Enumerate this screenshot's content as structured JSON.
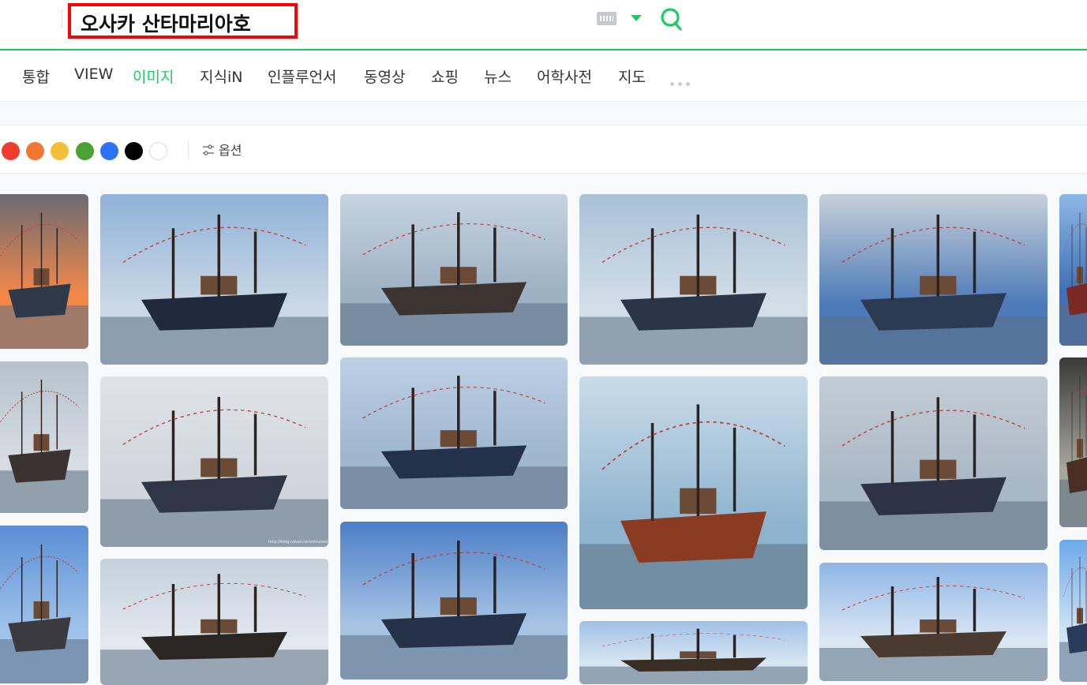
{
  "search": {
    "query": "오사카 산타마리아호"
  },
  "tabs": [
    {
      "label": "통합"
    },
    {
      "label": "VIEW"
    },
    {
      "label": "이미지",
      "active": true
    },
    {
      "label": "지식iN"
    },
    {
      "label": "인플루언서"
    },
    {
      "label": "동영상"
    },
    {
      "label": "쇼핑"
    },
    {
      "label": "뉴스"
    },
    {
      "label": "어학사전"
    },
    {
      "label": "지도"
    }
  ],
  "filters": {
    "colors": [
      "#ee3d2f",
      "#f07830",
      "#f6bd38",
      "#49a231",
      "#2d73f5",
      "#000000",
      "#ffffff"
    ],
    "options_label": "옵션"
  },
  "colors": {
    "accent": "#19ce60",
    "highlight_box": "#ff0000"
  },
  "images": [
    {
      "subject": "ship-sunset"
    },
    {
      "subject": "ship-blue-sky-pier"
    },
    {
      "subject": "ship-distance-pier"
    },
    {
      "subject": "ship-closeup-pier"
    },
    {
      "subject": "ship-cloudy-sky"
    },
    {
      "subject": "ship-partial"
    },
    {
      "subject": "ship-crowd"
    },
    {
      "subject": "ship-side-calm-water"
    },
    {
      "subject": "ship-with-boat"
    },
    {
      "subject": "ship-through-fence-cross-sail"
    },
    {
      "subject": "ship-overcast-harbor"
    },
    {
      "subject": "ship-dark-partial"
    },
    {
      "subject": "ship-close-mast"
    },
    {
      "subject": "ship-silhouette"
    },
    {
      "subject": "ship-blue-sky-boat"
    },
    {
      "subject": "ship-flags"
    },
    {
      "subject": "ship-mast-flags"
    },
    {
      "subject": "ship-partial-right"
    }
  ],
  "watermark": {
    "text": "http://blog.naver.com/strussel"
  }
}
